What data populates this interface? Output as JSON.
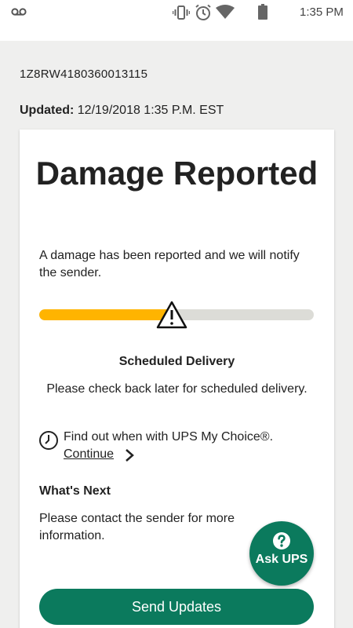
{
  "status_bar": {
    "time": "1:35 PM",
    "icons": [
      "voicemail-icon",
      "vibrate-icon",
      "alarm-icon",
      "wifi-icon",
      "battery-icon"
    ]
  },
  "shipment": {
    "tracking_number": "1Z8RW4180360013115",
    "updated_label": "Updated:",
    "updated_value": "12/19/2018 1:35 P.M. EST"
  },
  "status": {
    "title": "Damage Reported",
    "description": "A damage has been reported and we will notify the sender.",
    "progress_fraction": 0.48,
    "progress_color": "#ffb400",
    "progress_marker_icon": "warning-icon"
  },
  "scheduled": {
    "title": "Scheduled Delivery",
    "description": "Please check back later for scheduled delivery."
  },
  "my_choice": {
    "icon": "clock-icon",
    "text": "Find out when with UPS My Choice®.",
    "link_label": "Continue"
  },
  "whats_next": {
    "title": "What's Next",
    "description": "Please contact the sender for more information."
  },
  "ask_ups": {
    "icon": "help-icon",
    "label": "Ask UPS"
  },
  "actions": {
    "send_updates_label": "Send Updates"
  },
  "colors": {
    "brand_green": "#0b7a5d",
    "warning_yellow": "#ffb400"
  }
}
